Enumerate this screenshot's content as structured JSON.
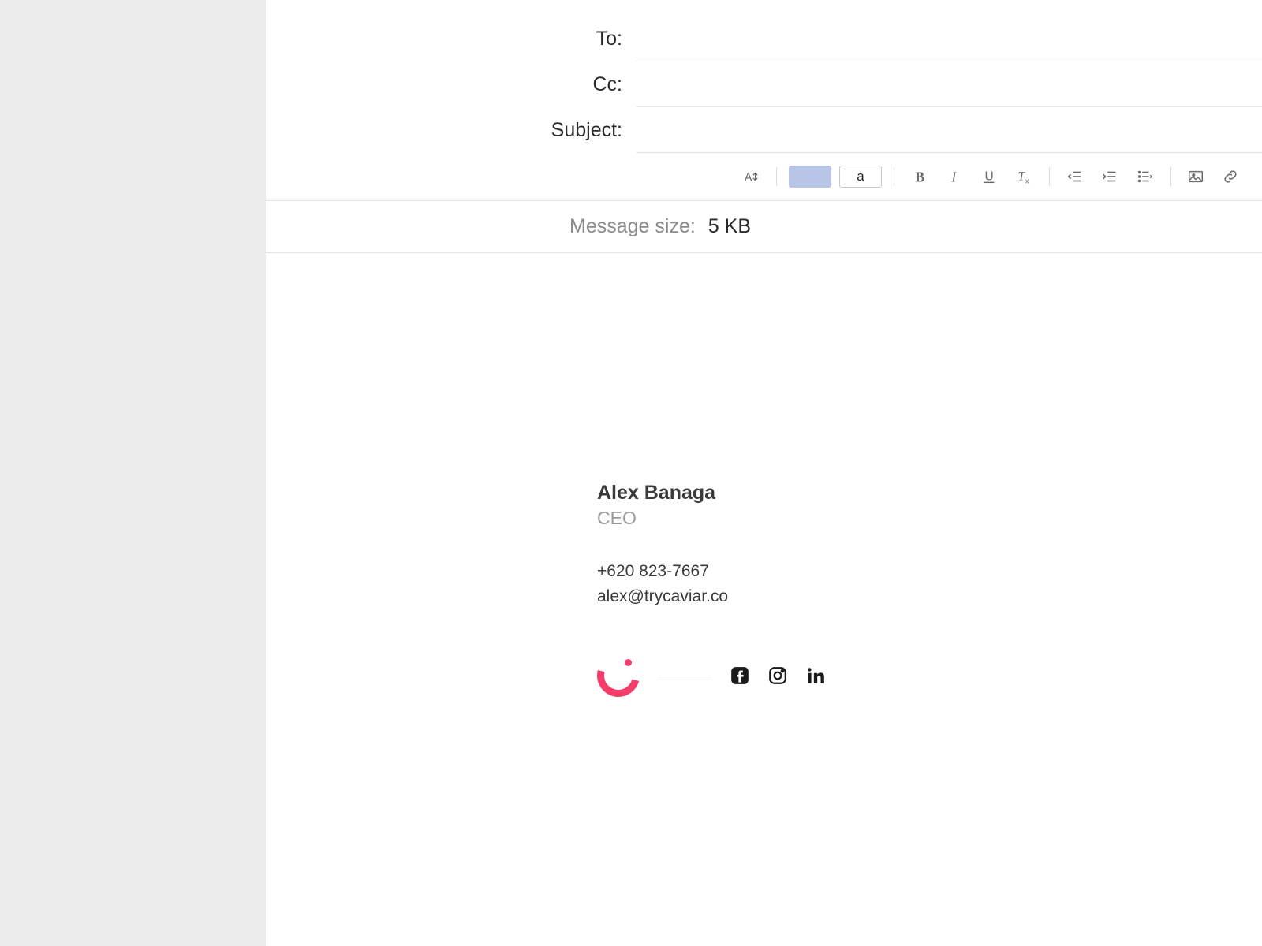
{
  "fields": {
    "to_label": "To:",
    "cc_label": "Cc:",
    "subject_label": "Subject:",
    "to_value": "",
    "cc_value": "",
    "subject_value": ""
  },
  "toolbar": {
    "textcolor_char": "a"
  },
  "message_size": {
    "label": "Message size:",
    "value": "5 KB"
  },
  "signature": {
    "name": "Alex Banaga",
    "title": "CEO",
    "phone": "+620 823-7667",
    "email": "alex@trycaviar.co"
  },
  "colors": {
    "accent": "#f53d6b",
    "highlight_swatch": "#b9c5e6"
  }
}
